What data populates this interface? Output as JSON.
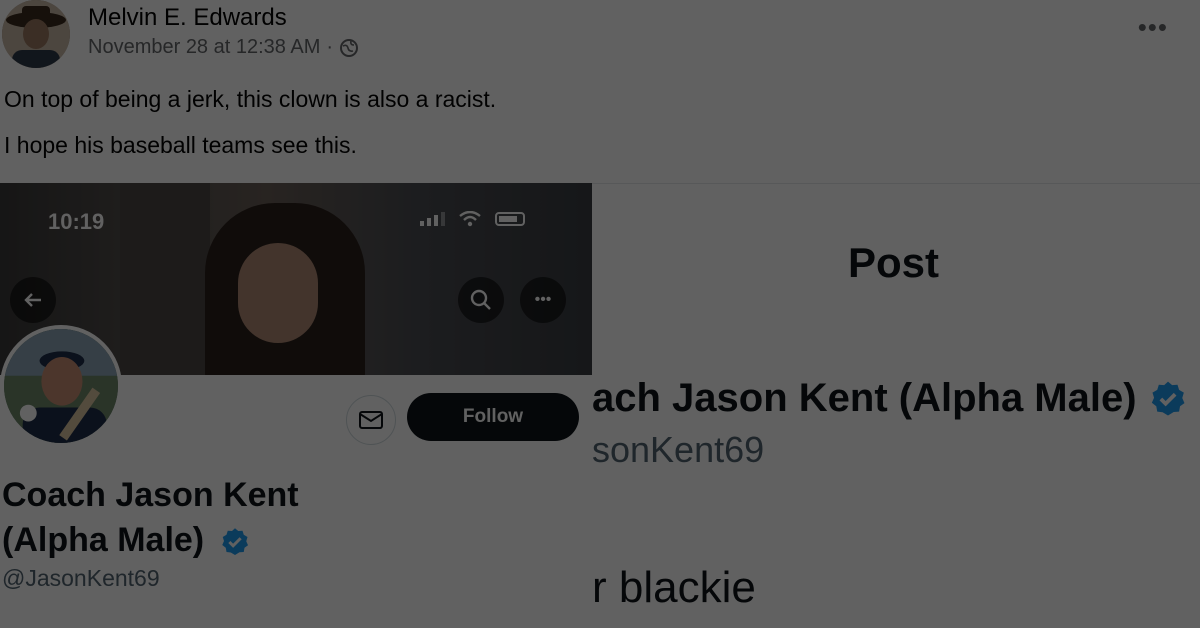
{
  "fb_post": {
    "author": "Melvin E. Edwards",
    "timestamp": "November 28 at 12:38 AM",
    "visibility_icon": "globe-icon",
    "more_icon": "more-dots-icon",
    "more_label": "•••",
    "line1": "On top of being a jerk, this clown is also a racist.",
    "line2": "I hope his baseball teams see this."
  },
  "left_screenshot": {
    "status_time": "10:19",
    "back_icon": "back-arrow-icon",
    "search_icon": "search-icon",
    "more_icon": "more-icon",
    "more_label": "•••",
    "mail_icon": "mail-icon",
    "follow_label": "Follow",
    "name_line1": "Coach Jason Kent",
    "name_line2": "(Alpha Male)",
    "verified_icon": "verified-badge-icon",
    "handle": "@JasonKent69"
  },
  "right_screenshot": {
    "title": "Post",
    "name_partial": "ach Jason Kent (Alpha Male)",
    "handle_partial": "sonKent69",
    "text_partial": "r blackie",
    "verified_icon": "verified-badge-icon"
  },
  "colors": {
    "verified": "#1d9bf0",
    "follow_bg": "#0f1419",
    "overlay": "rgba(0,0,0,0.62)"
  }
}
